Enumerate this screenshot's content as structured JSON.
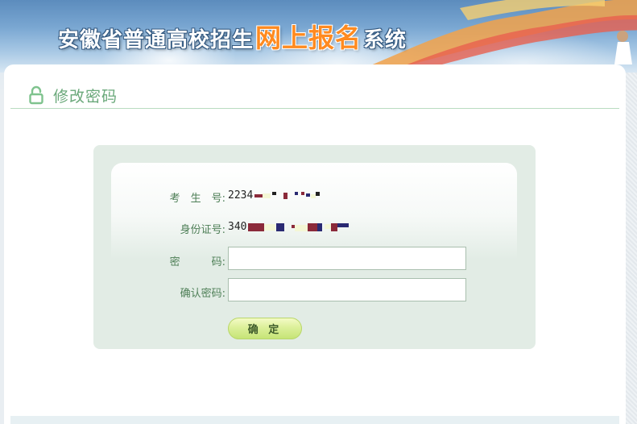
{
  "header": {
    "title_part1": "安徽省普通高校招生",
    "title_part2": "网上报名",
    "title_part3": "系统"
  },
  "section": {
    "title": "修改密码",
    "icon": "lock-icon"
  },
  "form": {
    "exam_id": {
      "label": "考　生　号:",
      "value_prefix": "2234"
    },
    "id_card": {
      "label": "身份证号:",
      "value_prefix": "340"
    },
    "password": {
      "label": "密　　　码:",
      "value": ""
    },
    "confirm_password": {
      "label": "确认密码:",
      "value": ""
    },
    "submit_label": "确 定"
  },
  "colors": {
    "accent_green": "#6aa87a",
    "label_green": "#4e7f57",
    "title_orange": "#ff8a1f",
    "panel_bg": "#e2ece5"
  }
}
